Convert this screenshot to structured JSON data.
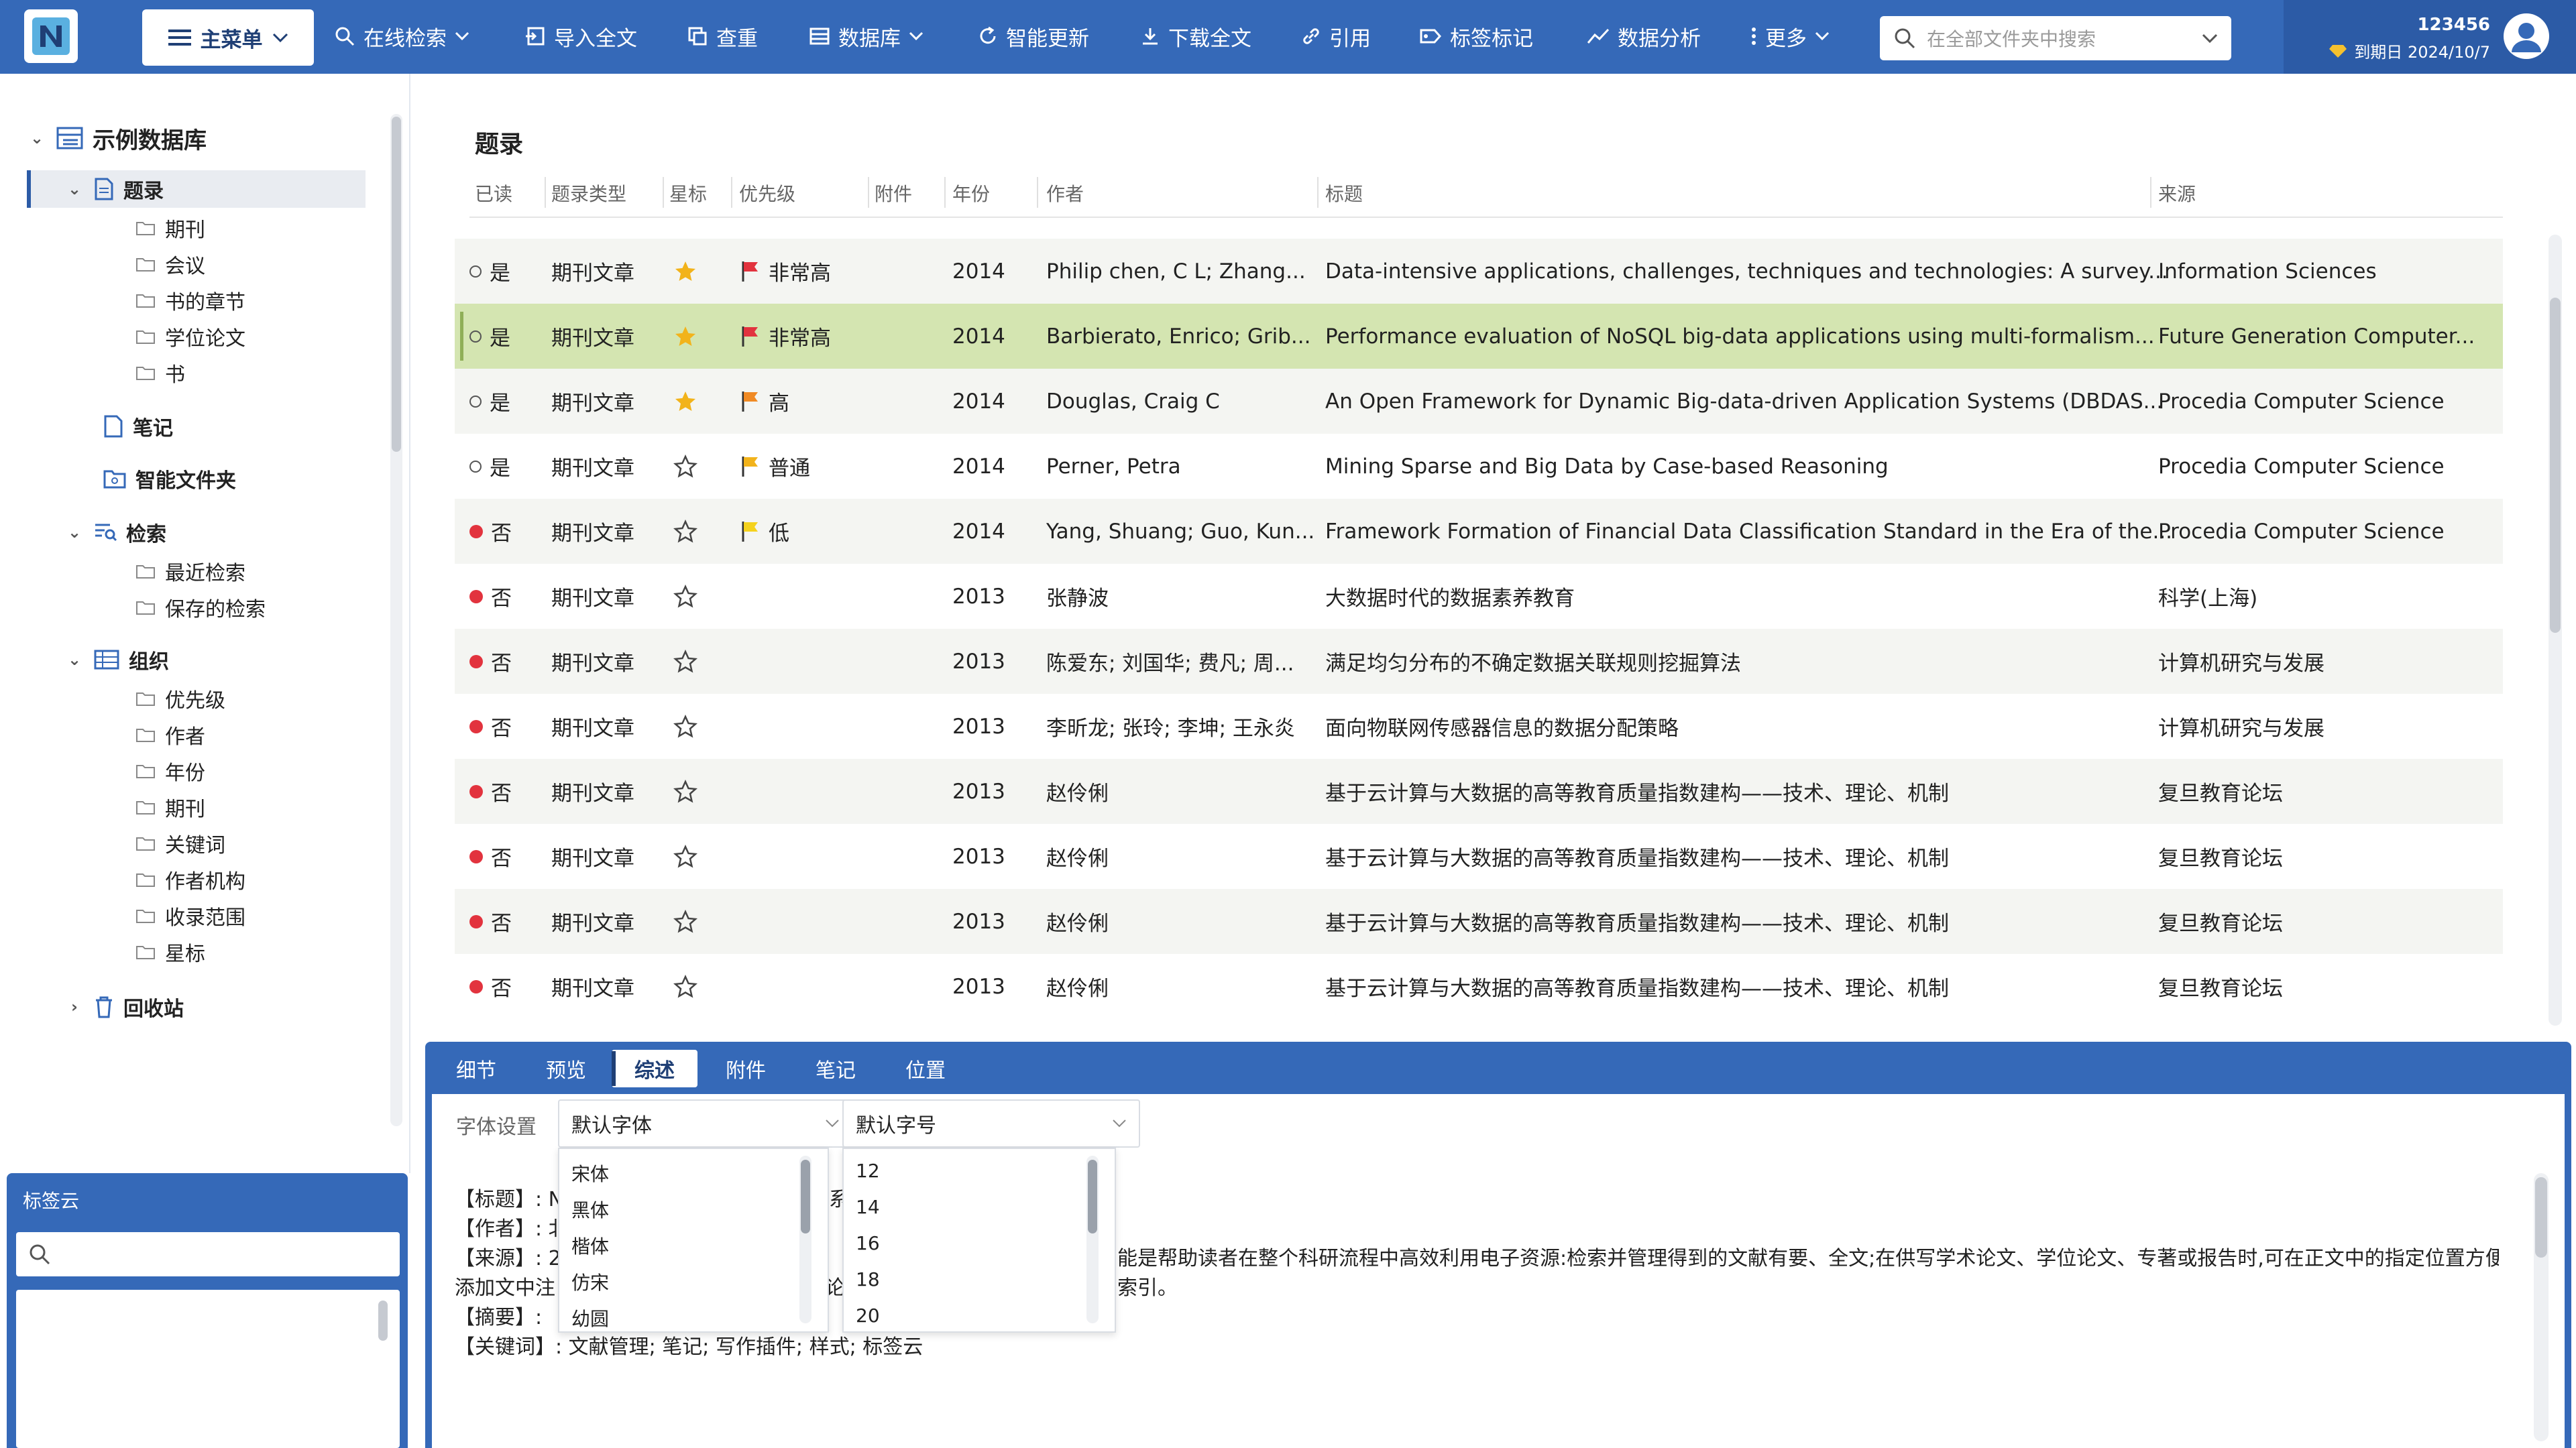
{
  "topbar": {
    "main_menu_label": "主菜单",
    "items": [
      {
        "label": "在线检索",
        "icon": "search-icon",
        "dropdown": true
      },
      {
        "label": "导入全文",
        "icon": "import-icon",
        "dropdown": false
      },
      {
        "label": "查重",
        "icon": "duplicate-icon",
        "dropdown": false
      },
      {
        "label": "数据库",
        "icon": "database-icon",
        "dropdown": true
      },
      {
        "label": "智能更新",
        "icon": "refresh-icon",
        "dropdown": false
      },
      {
        "label": "下载全文",
        "icon": "download-icon",
        "dropdown": false
      },
      {
        "label": "引用",
        "icon": "link-icon",
        "dropdown": false
      },
      {
        "label": "标签标记",
        "icon": "tag-icon",
        "dropdown": false
      },
      {
        "label": "数据分析",
        "icon": "chart-icon",
        "dropdown": false
      },
      {
        "label": "更多",
        "icon": "more-icon",
        "dropdown": true
      }
    ],
    "search_placeholder": "在全部文件夹中搜索",
    "user_id": "123456",
    "expire_text": "到期日 2024/10/7"
  },
  "sidebar": {
    "database_name": "示例数据库",
    "nodes": {
      "records": "题录",
      "records_children": [
        "期刊",
        "会议",
        "书的章节",
        "学位论文",
        "书"
      ],
      "notes": "笔记",
      "smart_folder": "智能文件夹",
      "search": "检索",
      "search_children": [
        "最近检索",
        "保存的检索"
      ],
      "organize": "组织",
      "organize_children": [
        "优先级",
        "作者",
        "年份",
        "期刊",
        "关键词",
        "作者机构",
        "收录范围",
        "星标"
      ],
      "trash": "回收站"
    }
  },
  "tag_cloud": {
    "title": "标签云",
    "search_value": ""
  },
  "list": {
    "title": "题录",
    "columns": [
      "已读",
      "题录类型",
      "星标",
      "优先级",
      "附件",
      "年份",
      "作者",
      "标题",
      "来源"
    ],
    "rows": [
      {
        "read": "是",
        "type": "期刊文章",
        "starred": true,
        "priority": "非常高",
        "priority_color": "#e2333e",
        "year": "2014",
        "author": "Philip chen, C L; Zhang...",
        "title": "Data-intensive applications, challenges, techniques and technologies: A survey...",
        "source": "Information Sciences"
      },
      {
        "read": "是",
        "type": "期刊文章",
        "starred": true,
        "priority": "非常高",
        "priority_color": "#e2333e",
        "year": "2014",
        "author": "Barbierato, Enrico; Grib...",
        "title": "Performance evaluation of NoSQL big-data applications using multi-formalism...",
        "source": "Future Generation Computer..."
      },
      {
        "read": "是",
        "type": "期刊文章",
        "starred": true,
        "priority": "高",
        "priority_color": "#f08a24",
        "year": "2014",
        "author": "Douglas, Craig C",
        "title": "An Open Framework for Dynamic Big-data-driven Application Systems (DBDAS...",
        "source": "Procedia Computer Science"
      },
      {
        "read": "是",
        "type": "期刊文章",
        "starred": false,
        "priority": "普通",
        "priority_color": "#f2b31b",
        "year": "2014",
        "author": "Perner, Petra",
        "title": "Mining Sparse and Big Data by Case-based Reasoning",
        "source": "Procedia Computer Science"
      },
      {
        "read": "否",
        "type": "期刊文章",
        "starred": false,
        "priority": "低",
        "priority_color": "#f5d21e",
        "year": "2014",
        "author": "Yang, Shuang; Guo, Kun...",
        "title": "Framework Formation of Financial Data Classification Standard in the Era of the...",
        "source": "Procedia Computer Science"
      },
      {
        "read": "否",
        "type": "期刊文章",
        "starred": false,
        "priority": "",
        "priority_color": "",
        "year": "2013",
        "author": "张静波",
        "title": "大数据时代的数据素养教育",
        "source": "科学(上海)"
      },
      {
        "read": "否",
        "type": "期刊文章",
        "starred": false,
        "priority": "",
        "priority_color": "",
        "year": "2013",
        "author": "陈爱东; 刘国华; 费凡; 周...",
        "title": "满足均匀分布的不确定数据关联规则挖掘算法",
        "source": "计算机研究与发展"
      },
      {
        "read": "否",
        "type": "期刊文章",
        "starred": false,
        "priority": "",
        "priority_color": "",
        "year": "2013",
        "author": "李昕龙; 张玲; 李坤; 王永炎",
        "title": "面向物联网传感器信息的数据分配策略",
        "source": "计算机研究与发展"
      },
      {
        "read": "否",
        "type": "期刊文章",
        "starred": false,
        "priority": "",
        "priority_color": "",
        "year": "2013",
        "author": "赵伶俐",
        "title": "基于云计算与大数据的高等教育质量指数建构——技术、理论、机制",
        "source": "复旦教育论坛"
      },
      {
        "read": "否",
        "type": "期刊文章",
        "starred": false,
        "priority": "",
        "priority_color": "",
        "year": "2013",
        "author": "赵伶俐",
        "title": "基于云计算与大数据的高等教育质量指数建构——技术、理论、机制",
        "source": "复旦教育论坛"
      },
      {
        "read": "否",
        "type": "期刊文章",
        "starred": false,
        "priority": "",
        "priority_color": "",
        "year": "2013",
        "author": "赵伶俐",
        "title": "基于云计算与大数据的高等教育质量指数建构——技术、理论、机制",
        "source": "复旦教育论坛"
      },
      {
        "read": "否",
        "type": "期刊文章",
        "starred": false,
        "priority": "",
        "priority_color": "",
        "year": "2013",
        "author": "赵伶俐",
        "title": "基于云计算与大数据的高等教育质量指数建构——技术、理论、机制",
        "source": "复旦教育论坛"
      }
    ],
    "selected_row": 1
  },
  "bottom": {
    "tabs": [
      "细节",
      "预览",
      "综述",
      "附件",
      "笔记",
      "位置"
    ],
    "active_tab": "综述",
    "font_setting_label": "字体设置",
    "font_family_value": "默认字体",
    "font_size_value": "默认字号",
    "font_family_options": [
      "宋体",
      "黑体",
      "楷体",
      "仿宋",
      "幼圆"
    ],
    "font_size_options": [
      "12",
      "14",
      "16",
      "18",
      "20"
    ],
    "summary": {
      "title_line_a": "【标题】: No",
      "title_line_b": "系",
      "author_line": "【作者】: 北京",
      "source_line_a": "【来源】: 20",
      "source_line_b": "能是帮助读者在整个科研流程中高效利用电子资源:检索并管理得到的文献有要、全文;在供写学术论文、学位论文、专著或报告时,可在正文中的指定位置方便地",
      "source_line_c": "添加文中注",
      "source_line_d": "论",
      "source_line_e": "索引。",
      "abstract_line": "【摘要】:",
      "keywords_line": "【关键词】: 文献管理; 笔记; 写作插件; 样式; 标签云"
    }
  },
  "colors": {
    "primary": "#3569b8",
    "primary_dark": "#2c5ba6",
    "selected_row": "#d4e5b1",
    "unread_dot": "#e2333e",
    "star": "#f2b31b"
  }
}
